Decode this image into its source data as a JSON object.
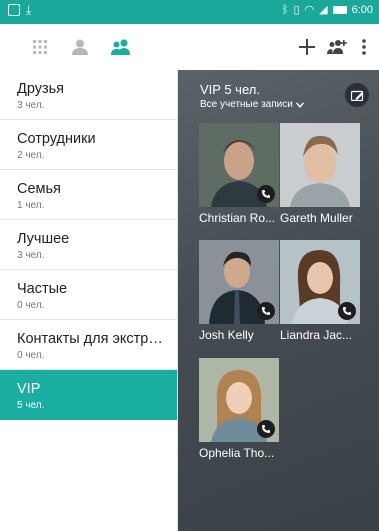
{
  "status": {
    "time": "6:00",
    "icons": [
      "notification-icon",
      "download-icon",
      "bluetooth-icon",
      "vibrate-icon",
      "wifi-icon",
      "signal-icon",
      "battery-icon"
    ]
  },
  "appbar": {
    "tabs": [
      "dialpad-grid-icon",
      "contact-person-icon",
      "groups-icon"
    ],
    "actions": [
      "add-icon",
      "add-group-icon",
      "more-icon"
    ],
    "accent": "#1aaea1"
  },
  "groups": [
    {
      "name": "Друзья",
      "count": "3 чел."
    },
    {
      "name": "Сотрудники",
      "count": "2 чел."
    },
    {
      "name": "Семья",
      "count": "1 чел."
    },
    {
      "name": "Лучшее",
      "count": "3 чел."
    },
    {
      "name": "Частые",
      "count": "0 чел."
    },
    {
      "name": "Контакты для экстрен...",
      "count": "0 чел."
    },
    {
      "name": "VIP",
      "count": "5 чел."
    }
  ],
  "detail": {
    "title": "VIP 5 чел.",
    "account_filter": "Все учетные записи",
    "contacts": [
      {
        "name": "Christian Ro...",
        "has_call": true
      },
      {
        "name": "Gareth Muller",
        "has_call": false
      },
      {
        "name": "Josh Kelly",
        "has_call": true
      },
      {
        "name": "Liandra Jac...",
        "has_call": true
      },
      {
        "name": "Ophelia Tho...",
        "has_call": true
      }
    ]
  }
}
